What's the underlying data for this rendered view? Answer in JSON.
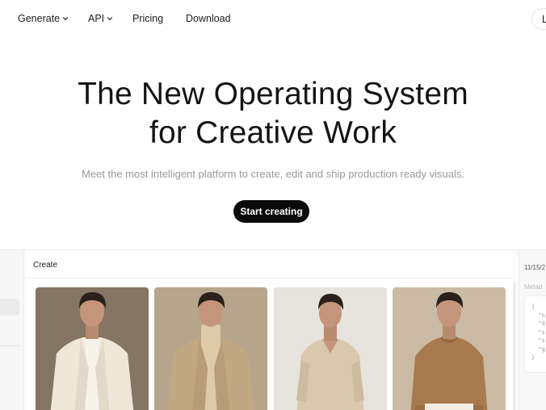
{
  "nav": {
    "items": [
      {
        "label": "Generate",
        "has_dropdown": true
      },
      {
        "label": "API",
        "has_dropdown": true
      },
      {
        "label": "Pricing",
        "has_dropdown": false
      },
      {
        "label": "Download",
        "has_dropdown": false
      }
    ],
    "login_label": "L"
  },
  "hero": {
    "title_line1": "The New Operating System",
    "title_line2": "for Creative Work",
    "subtitle": "Meet the most intelligent platform to create, edit and ship production ready visuals.",
    "cta_label": "Start creating"
  },
  "app": {
    "panel_title": "Create",
    "right_panel": {
      "date": "11/15/2",
      "metadata_label": "Metad",
      "code_lines": [
        "{",
        "  \"n",
        "  \"d",
        "  \"s",
        "  \"s",
        "  \"g",
        "}"
      ]
    },
    "photos": [
      {
        "name": "man-cream-linen-blazer",
        "bg": "#8a7a68",
        "jacket": "#efe7d8",
        "shirt": "#f7f3ec"
      },
      {
        "name": "man-tan-turtleneck-blazer",
        "bg": "#b7a48c",
        "jacket": "#c7ad8c",
        "shirt": "#dccaa9"
      },
      {
        "name": "man-beige-linen-shirt",
        "bg": "#e7e3dd",
        "jacket": "#d9c8ad",
        "shirt": "#d9c8ad"
      },
      {
        "name": "man-brown-knit-sweater",
        "bg": "#cbbaa4",
        "jacket": "#a97a4f",
        "shirt": "#a97a4f"
      }
    ]
  },
  "colors": {
    "cta_bg": "#0b0b0b",
    "subtitle": "#9a9a9a",
    "border": "#ececec"
  }
}
